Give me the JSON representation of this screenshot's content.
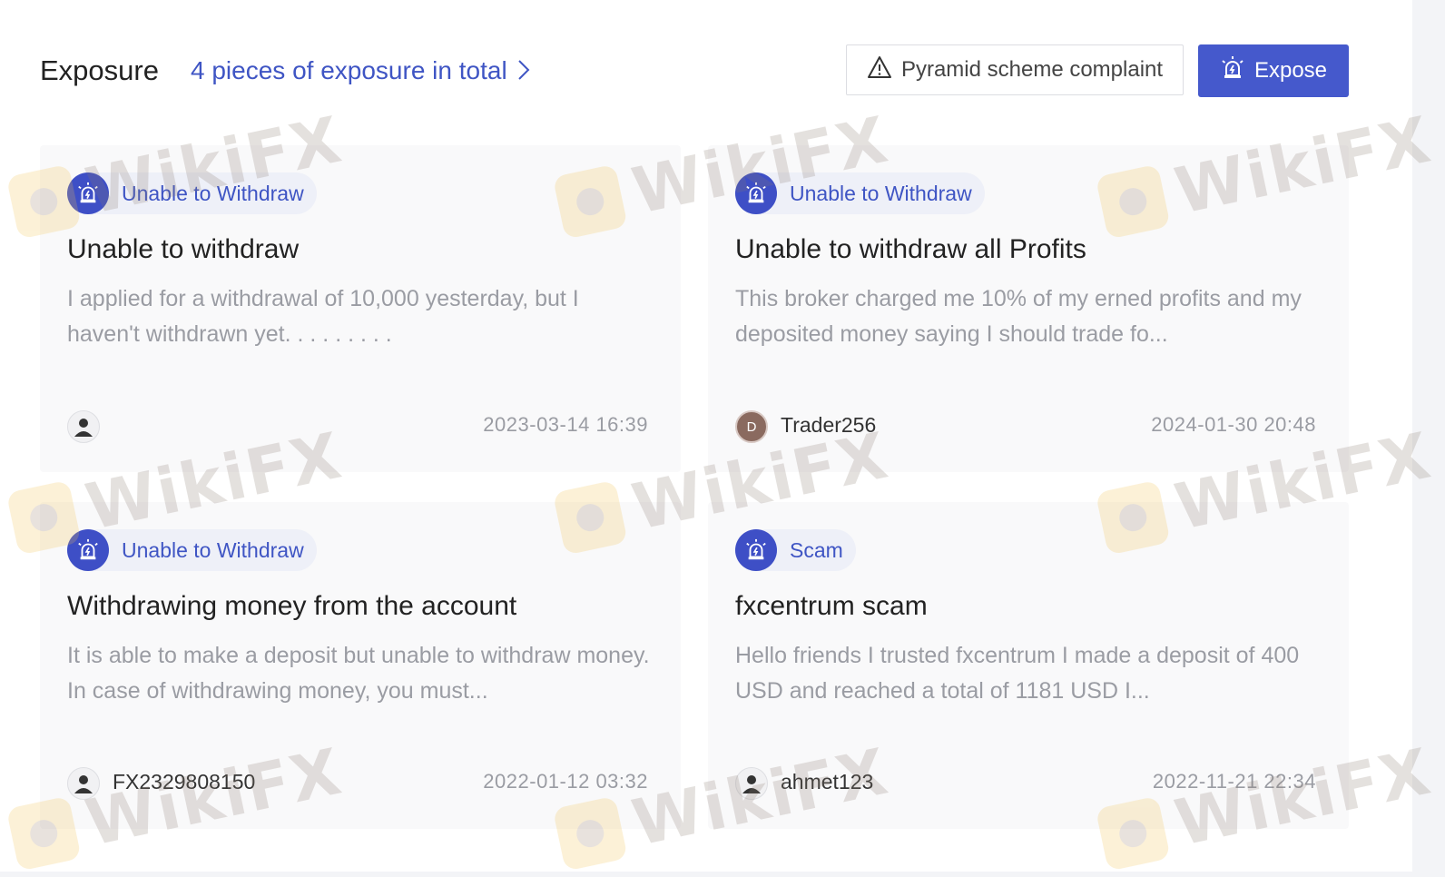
{
  "header": {
    "title": "Exposure",
    "count_link": "4 pieces of exposure in total",
    "complaint_button": "Pyramid scheme complaint",
    "expose_button": "Expose"
  },
  "cards": [
    {
      "tag": "Unable to Withdraw",
      "title": "Unable to withdraw",
      "body": "I applied for a withdrawal of 10,000 yesterday, but I haven't withdrawn yet. . . . . . . . .",
      "author": "",
      "avatar_letter": "",
      "date": "2023-03-14 16:39"
    },
    {
      "tag": "Unable to Withdraw",
      "title": "Unable to withdraw all Profits",
      "body": "This broker charged me 10% of my erned profits and my deposited money saying I should trade fo...",
      "author": "Trader256",
      "avatar_letter": "D",
      "date": "2024-01-30 20:48"
    },
    {
      "tag": "Unable to Withdraw",
      "title": "Withdrawing money from the account",
      "body": "It is able to make a deposit but unable to withdraw money. In case of withdrawing money, you must...",
      "author": "FX2329808150",
      "avatar_letter": "",
      "date": "2022-01-12 03:32"
    },
    {
      "tag": "Scam",
      "title": "fxcentrum scam",
      "body": "Hello friends I trusted fxcentrum I made a deposit of 400 USD and reached a total of 1181 USD I...",
      "author": "ahmet123",
      "avatar_letter": "",
      "date": "2022-11-21 22:34"
    }
  ],
  "watermark": "WikiFX",
  "colors": {
    "accent": "#4559cc",
    "tag_bg": "#eef0f8",
    "muted_text": "#9a9ca3"
  }
}
